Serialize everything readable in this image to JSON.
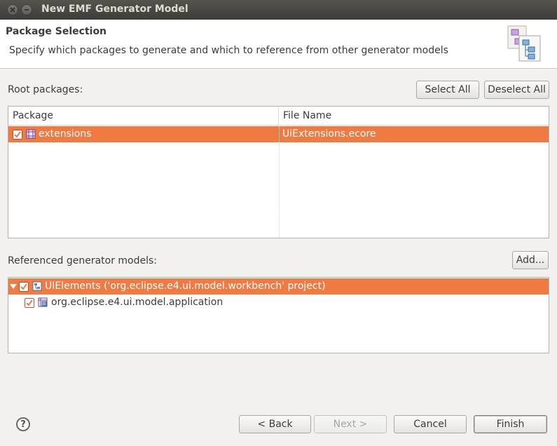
{
  "window": {
    "title": "New EMF Generator Model"
  },
  "header": {
    "title": "Package Selection",
    "description": "Specify which packages to generate and which to reference from other generator models"
  },
  "root_packages": {
    "label": "Root packages:",
    "select_all": "Select All",
    "deselect_all": "Deselect All",
    "columns": [
      "Package",
      "File Name"
    ],
    "rows": [
      {
        "package": "extensions",
        "file_name": "UiExtensions.ecore",
        "checked": true,
        "selected": true
      }
    ]
  },
  "referenced": {
    "label": "Referenced generator models:",
    "add": "Add...",
    "items": [
      {
        "label": "UIElements ('org.eclipse.e4.ui.model.workbench' project)",
        "checked": true,
        "expanded": true,
        "selected": true,
        "icon": "genmodel-icon"
      },
      {
        "label": "org.eclipse.e4.ui.model.application",
        "checked": true,
        "selected": false,
        "icon": "genpackage-icon"
      }
    ]
  },
  "footer": {
    "help": "?",
    "back": "< Back",
    "next": "Next >",
    "cancel": "Cancel",
    "finish": "Finish"
  },
  "colors": {
    "selection": "#ef7b43",
    "titlebar": "#3d3c38",
    "dialog_bg": "#f2f1f0"
  }
}
